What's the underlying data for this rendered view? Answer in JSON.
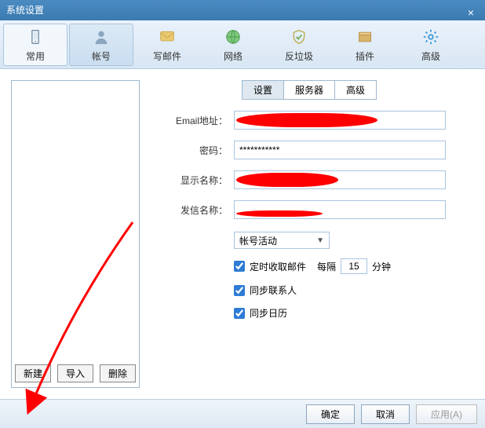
{
  "title": "系统设置",
  "toolbar": [
    {
      "key": "common",
      "label": "常用"
    },
    {
      "key": "account",
      "label": "帐号"
    },
    {
      "key": "compose",
      "label": "写邮件"
    },
    {
      "key": "network",
      "label": "网络"
    },
    {
      "key": "antispam",
      "label": "反垃圾"
    },
    {
      "key": "plugin",
      "label": "插件"
    },
    {
      "key": "advanced",
      "label": "高级"
    }
  ],
  "left_buttons": {
    "new": "新建",
    "import": "导入",
    "delete": "删除"
  },
  "inner_tabs": {
    "settings": "设置",
    "server": "服务器",
    "advanced": "高级"
  },
  "form": {
    "email_label": "Email地址：",
    "password_label": "密码：",
    "password_value": "***********",
    "display_name_label": "显示名称：",
    "sender_name_label": "发信名称：",
    "select_value": "帐号活动",
    "check_timed": "定时收取邮件",
    "interval_every": "每隔",
    "interval_value": "15",
    "interval_unit": "分钟",
    "check_contacts": "同步联系人",
    "check_calendar": "同步日历"
  },
  "footer": {
    "ok": "确定",
    "cancel": "取消",
    "apply": "应用(A)"
  }
}
